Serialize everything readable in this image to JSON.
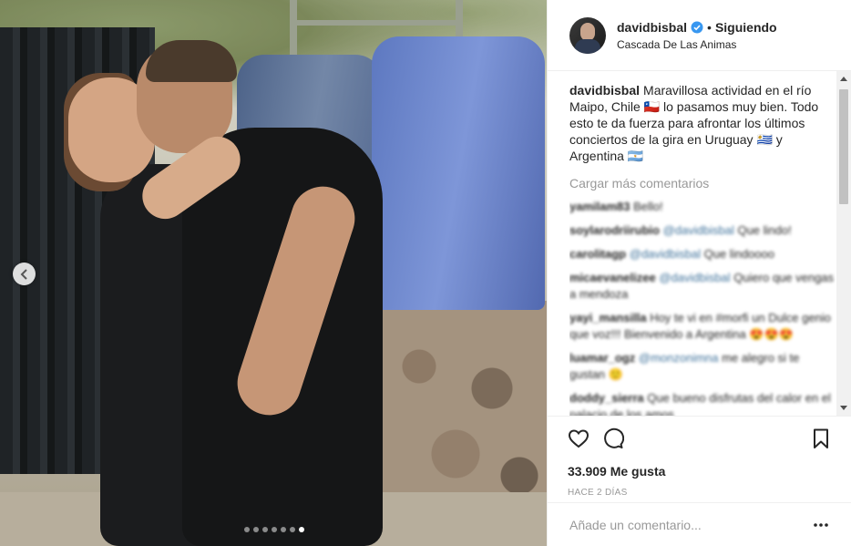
{
  "post": {
    "carousel": {
      "slides_total": 7,
      "active_slide": 7
    }
  },
  "header": {
    "username": "davidbisbal",
    "separator": "•",
    "follow_label": "Siguiendo",
    "location": "Cascada De Las Animas",
    "icons": {
      "verified": "verified-badge-icon"
    }
  },
  "caption": {
    "username": "davidbisbal",
    "text": "Maravillosa actividad en el río Maipo, Chile 🇨🇱 lo pasamos muy bien. Todo esto te da fuerza para afrontar los últimos conciertos de la gira en Uruguay 🇺🇾 y Argentina 🇦🇷"
  },
  "load_more_label": "Cargar más comentarios",
  "comments": [
    {
      "user": "yamilam83",
      "text": "Bello!",
      "mention": ""
    },
    {
      "user": "soylarodriirubio",
      "text": "Que lindo!",
      "mention": "@davidbisbal"
    },
    {
      "user": "carolitagp",
      "text": "Que lindoooo",
      "mention": "@davidbisbal"
    },
    {
      "user": "micaevanelizee",
      "text": "Quiero que vengas a mendoza",
      "mention": "@davidbisbal"
    },
    {
      "user": "yayi_mansilla",
      "text": "Hoy te vi en #morfi un Dulce genio que voz!!! Bienvenido a Argentina 😍😍😍",
      "mention": ""
    },
    {
      "user": "luamar_ogz",
      "text": "me alegro si te gustan 🙂",
      "mention": "@monzonimna"
    },
    {
      "user": "doddy_sierra",
      "text": "Que bueno disfrutas del calor en el palacio de los amos",
      "mention": ""
    }
  ],
  "actions": {
    "likes_count": "33.909",
    "likes_label": "Me gusta",
    "time_ago": "HACE 2 DÍAS",
    "icons": {
      "like": "heart-icon",
      "comment": "comment-bubble-icon",
      "save": "bookmark-icon",
      "more": "more-options-icon"
    }
  },
  "comment_box": {
    "placeholder": "Añade un comentario..."
  },
  "colors": {
    "text": "#262626",
    "muted": "#999999",
    "verified": "#3897f0",
    "border": "#efefef",
    "mention": "#3f729b"
  }
}
